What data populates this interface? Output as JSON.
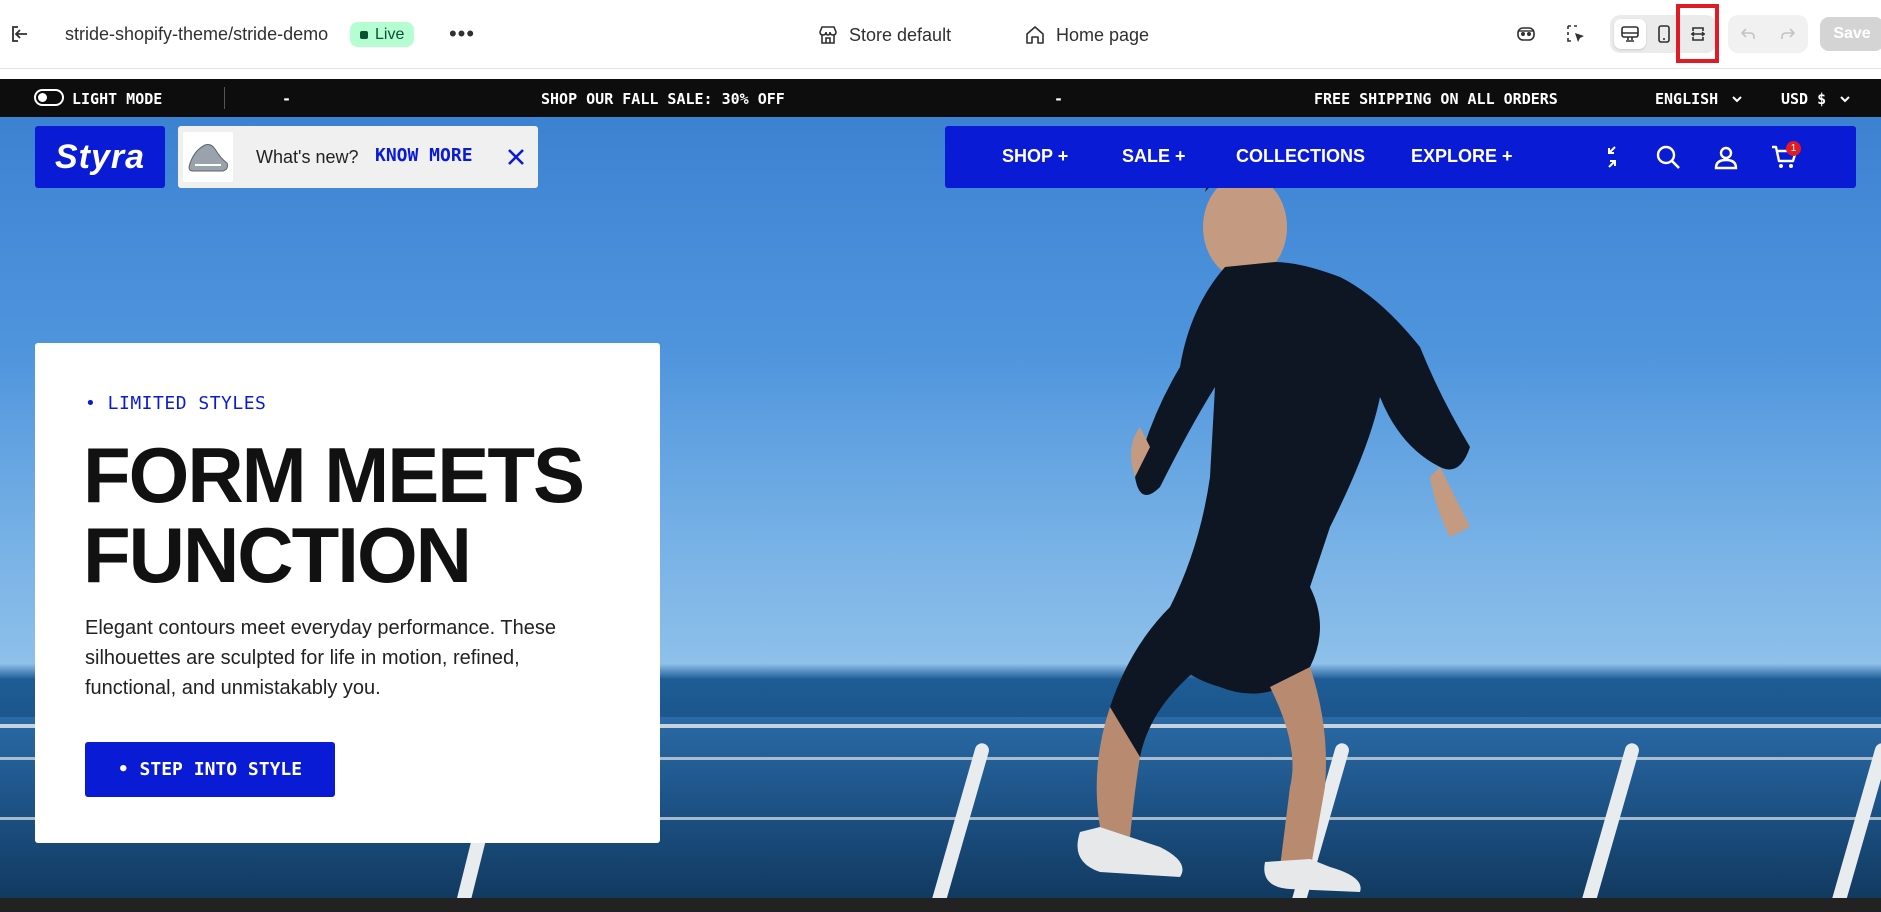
{
  "editor": {
    "theme_name": "stride-shopify-theme/stride-demo",
    "status": "Live",
    "more": "•••",
    "store_selector": "Store default",
    "page_selector": "Home page",
    "save_label": "Save"
  },
  "announcement": {
    "mode_label": "LIGHT MODE",
    "sep_left": "-",
    "message_1": "SHOP OUR FALL SALE: 30% OFF",
    "sep_mid": "-",
    "message_2": "FREE SHIPPING ON ALL ORDERS",
    "language": "ENGLISH",
    "currency": "USD $"
  },
  "header": {
    "logo": "Styra",
    "promo_text": "What's new?",
    "promo_link": "KNOW MORE",
    "nav": [
      "SHOP +",
      "SALE +",
      "COLLECTIONS",
      "EXPLORE +"
    ],
    "cart_count": "1"
  },
  "hero": {
    "eyebrow": "• LIMITED STYLES",
    "title_line1": "FORM MEETS",
    "title_line2": "FUNCTION",
    "description": "Elegant contours meet everyday performance. These silhouettes are sculpted for life in motion, refined, functional, and unmistakably you.",
    "cta": "• STEP INTO STYLE"
  },
  "colors": {
    "brand_blue": "#0a1bd6",
    "live_green_bg": "#b4fed2",
    "highlight_red": "#e01b24"
  },
  "icons": [
    "exit-icon",
    "store-icon",
    "home-icon",
    "accessibility-icon",
    "inspector-icon",
    "desktop-icon",
    "mobile-icon",
    "fullscreen-icon",
    "undo-icon",
    "redo-icon",
    "compare-icon",
    "search-icon",
    "account-icon",
    "cart-icon",
    "close-icon",
    "chevron-down-icon"
  ]
}
